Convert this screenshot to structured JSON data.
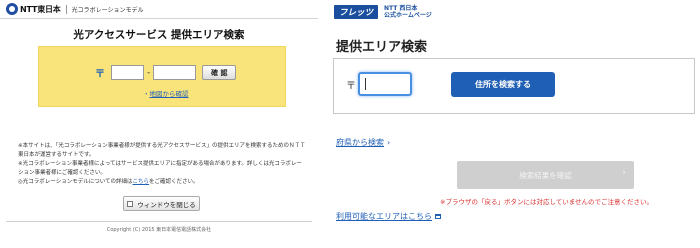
{
  "left": {
    "logo_text": "NTT東日本",
    "header_sub": "光コラボレーションモデル",
    "title": "光アクセスサービス 提供エリア検索",
    "zip_mark": "〒",
    "zip_dash": "-",
    "zip1_value": "",
    "zip2_value": "",
    "confirm_label": "確 認",
    "pref_link_bullet": "・",
    "pref_link": "地図から確認",
    "notes": [
      "※本サイトは、「光コラボレーション事業者様が提供する光アクセスサービス」の提供エリアを検索するためのＮＴＴ東日本が運営するサイトです。",
      "※光コラボレーション事業者様によってはサービス提供エリアに指定がある場合があります。詳しくは光コラボレーション事業者様にご確認ください。"
    ],
    "note3_prefix": "◎光コラボレーションモデルについての詳細は",
    "note3_link": "こちら",
    "note3_suffix": "をご確認ください。",
    "close_label": "ウィンドウを閉じる",
    "copyright": "Copyright (C) 2015 東日本電信電話株式会社"
  },
  "right": {
    "flets_logo": "フレッツ",
    "brand_line1": "NTT 西日本",
    "brand_line2": "公式ホームページ",
    "title": "提供エリア検索",
    "zip_mark": "〒",
    "zip_value": "",
    "search_label": "住所を検索する",
    "pref_link": "府県から検索",
    "pref_chevron": "›",
    "result_label": "検索結果を確認",
    "result_chevron": "›",
    "warning": "※ブラウザの「戻る」ボタンには対応していませんのでご注意ください。",
    "avail_link": "利用可能なエリアはこちら"
  },
  "colors": {
    "yellow_panel": "#f9e47b",
    "link_blue": "#1f5fb5",
    "search_button": "#1f5fb5",
    "disabled_button": "#cfcfcf",
    "warning_red": "#d93333"
  }
}
